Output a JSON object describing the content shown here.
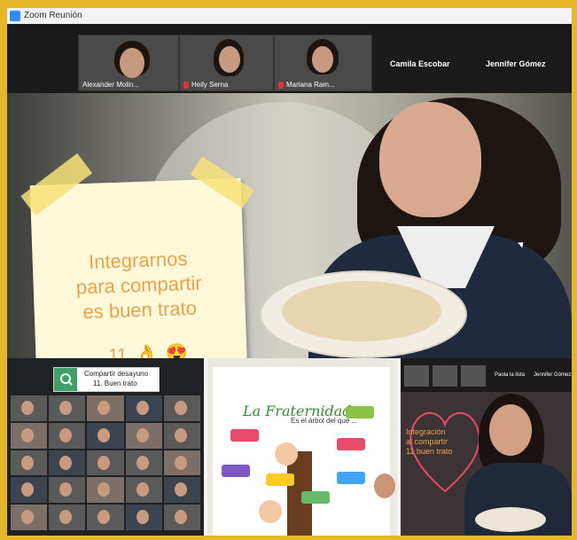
{
  "window": {
    "title": "Zoom Reunión"
  },
  "participants_strip": [
    {
      "name": "Alexander Molin..."
    },
    {
      "name": "Heily Serna"
    },
    {
      "name": "Mariana Ram..."
    },
    {
      "name": "Camila Escobar"
    },
    {
      "name": "Jennifer Gómez"
    }
  ],
  "sticky_note": {
    "lines": [
      "Integrarnos",
      "para compartir",
      "es buen trato"
    ],
    "number": "11",
    "emoji_ok": "👌",
    "emoji_love": "😍"
  },
  "breakfast_chip": {
    "line1": "Compartir desayuno",
    "line2": "11. Buen trato"
  },
  "poster": {
    "title": "La Fraternidad",
    "subtitle": "Es el árbol del que ..."
  },
  "third_panel": {
    "caption_lines": [
      "Integración",
      "al compartir",
      "11 buen trato"
    ],
    "strip_names": [
      "Paola la lista",
      "Jennifer Gómez"
    ]
  },
  "colors": {
    "border": "#e7b72a",
    "sticky_text": "#e9a24e",
    "chip_icon": "#3fa06a",
    "mic_muted": "#dd3333"
  }
}
